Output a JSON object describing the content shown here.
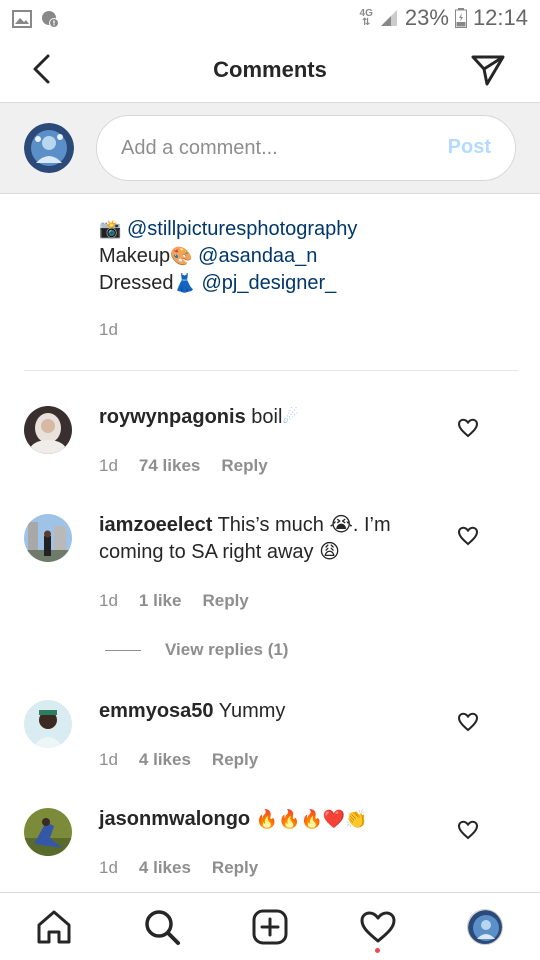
{
  "status_bar": {
    "network": "4G",
    "battery": "23%",
    "time": "12:14"
  },
  "header": {
    "title": "Comments"
  },
  "composer": {
    "placeholder": "Add a comment...",
    "post_label": "Post"
  },
  "caption": {
    "line1_emoji": "📸",
    "line1_mention": "@stillpicturesphotography",
    "line2_text": "Makeup",
    "line2_emoji": "🎨",
    "line2_mention": "@asandaa_n",
    "line3_text": "Dressed",
    "line3_emoji": "👗",
    "line3_mention": "@pj_designer_",
    "time": "1d"
  },
  "comments": [
    {
      "username": "roywynpagonis",
      "text": "boil",
      "emoji": "☄",
      "time": "1d",
      "likes": "74 likes",
      "reply": "Reply"
    },
    {
      "username": "iamzoeelect",
      "text": "This’s much 😭. I’m coming to SA right away 😩",
      "time": "1d",
      "likes": "1 like",
      "reply": "Reply",
      "view_replies": "View replies (1)"
    },
    {
      "username": "emmyosa50",
      "text": "Yummy",
      "time": "1d",
      "likes": "4 likes",
      "reply": "Reply"
    },
    {
      "username": "jasonmwalongo",
      "text": "🔥🔥🔥❤️👏",
      "time": "1d",
      "likes": "4 likes",
      "reply": "Reply"
    }
  ],
  "icons": {
    "back": "chevron-left-icon",
    "send": "paper-plane-icon",
    "like": "heart-outline-icon",
    "nav": [
      "home-icon",
      "search-icon",
      "add-post-icon",
      "activity-heart-icon",
      "profile-avatar"
    ]
  },
  "colors": {
    "mention": "#00376b",
    "post_disabled": "#b3dbff",
    "secondary_text": "#8e8e8e",
    "notification_dot": "#ed4956"
  }
}
